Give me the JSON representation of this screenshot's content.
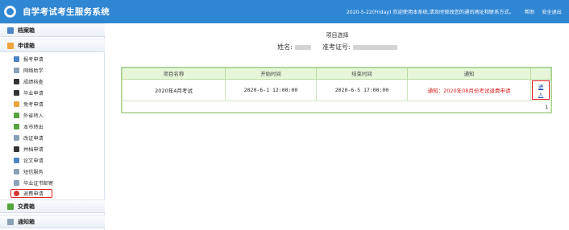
{
  "header": {
    "title": "自学考试考生服务系统",
    "notice": "2020-5-22(Friday) 欢迎使用本系统,请及时修改您的通讯地址和联系方式。",
    "help": "帮助",
    "logout": "安全退出",
    "color": "#2f86d3"
  },
  "sidebar": {
    "sections": [
      {
        "label": "档案箱"
      },
      {
        "label": "申请箱"
      },
      {
        "label": "交费箱"
      },
      {
        "label": "通知箱"
      }
    ],
    "items": [
      {
        "label": "报考申请",
        "icon": "document-icon"
      },
      {
        "label": "网络助学",
        "icon": "network-icon"
      },
      {
        "label": "成绩核查",
        "icon": "grade-icon"
      },
      {
        "label": "毕业申请",
        "icon": "graduation-cap-icon"
      },
      {
        "label": "免考申请",
        "icon": "pencil-icon"
      },
      {
        "label": "外省转入",
        "icon": "transfer-in-icon"
      },
      {
        "label": "本市转出",
        "icon": "transfer-out-icon"
      },
      {
        "label": "改证申请",
        "icon": "edit-id-icon"
      },
      {
        "label": "并档申请",
        "icon": "merge-icon"
      },
      {
        "label": "论文申请",
        "icon": "paper-icon"
      },
      {
        "label": "短信服务",
        "icon": "sms-icon"
      },
      {
        "label": "毕业证书邮寄",
        "icon": "mail-icon"
      },
      {
        "label": "退费申请",
        "icon": "refund-icon"
      }
    ],
    "active": "退费申请"
  },
  "main": {
    "page_title": "项目选择",
    "name_label": "姓名:",
    "exam_no_label": "准考证号:",
    "table": {
      "columns": [
        "项目名称",
        "开始时间",
        "结束时间",
        "通知",
        ""
      ],
      "rows": [
        {
          "name": "2020年4月考试",
          "start": "2020-6-1 12:00:00",
          "end": "2020-6-5 17:00:00",
          "notice": "通知：2020年08月份考试退费申请",
          "action": "进入"
        }
      ],
      "page": "1"
    }
  }
}
